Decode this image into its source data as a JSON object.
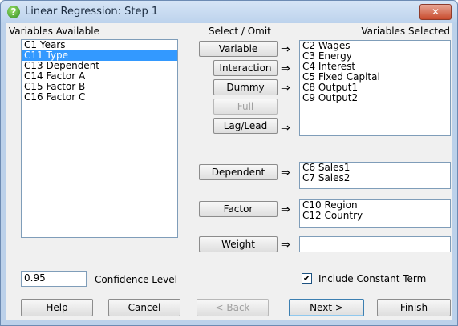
{
  "window": {
    "title": "Linear Regression: Step 1",
    "close_glyph": "✕"
  },
  "labels": {
    "variables_available": "Variables Available",
    "select_omit": "Select / Omit",
    "variables_selected": "Variables Selected",
    "confidence_level": "Confidence Level",
    "include_constant": "Include Constant Term"
  },
  "available_list": [
    "C1 Years",
    "C11 Type",
    "C13 Dependent",
    "C14 Factor A",
    "C15 Factor B",
    "C16 Factor C"
  ],
  "selected_list": [
    "C2 Wages",
    "C3 Energy",
    "C4 Interest",
    "C5 Fixed Capital",
    "C8 Output1",
    "C9 Output2"
  ],
  "dependent_list": [
    "C6 Sales1",
    "C7 Sales2"
  ],
  "factor_list": [
    "C10 Region",
    "C12 Country"
  ],
  "weight_list": [],
  "buttons": {
    "variable": "Variable",
    "interaction": "Interaction",
    "dummy": "Dummy",
    "full": "Full",
    "lag_lead": "Lag/Lead",
    "dependent": "Dependent",
    "factor": "Factor",
    "weight": "Weight",
    "help": "Help",
    "cancel": "Cancel",
    "back": "< Back",
    "next": "Next >",
    "finish": "Finish"
  },
  "arrow_glyph": "⇒",
  "confidence_value": "0.95",
  "include_constant_checked": true,
  "colors": {
    "selection": "#3399ff",
    "title_bar": "#bcd1ea"
  }
}
